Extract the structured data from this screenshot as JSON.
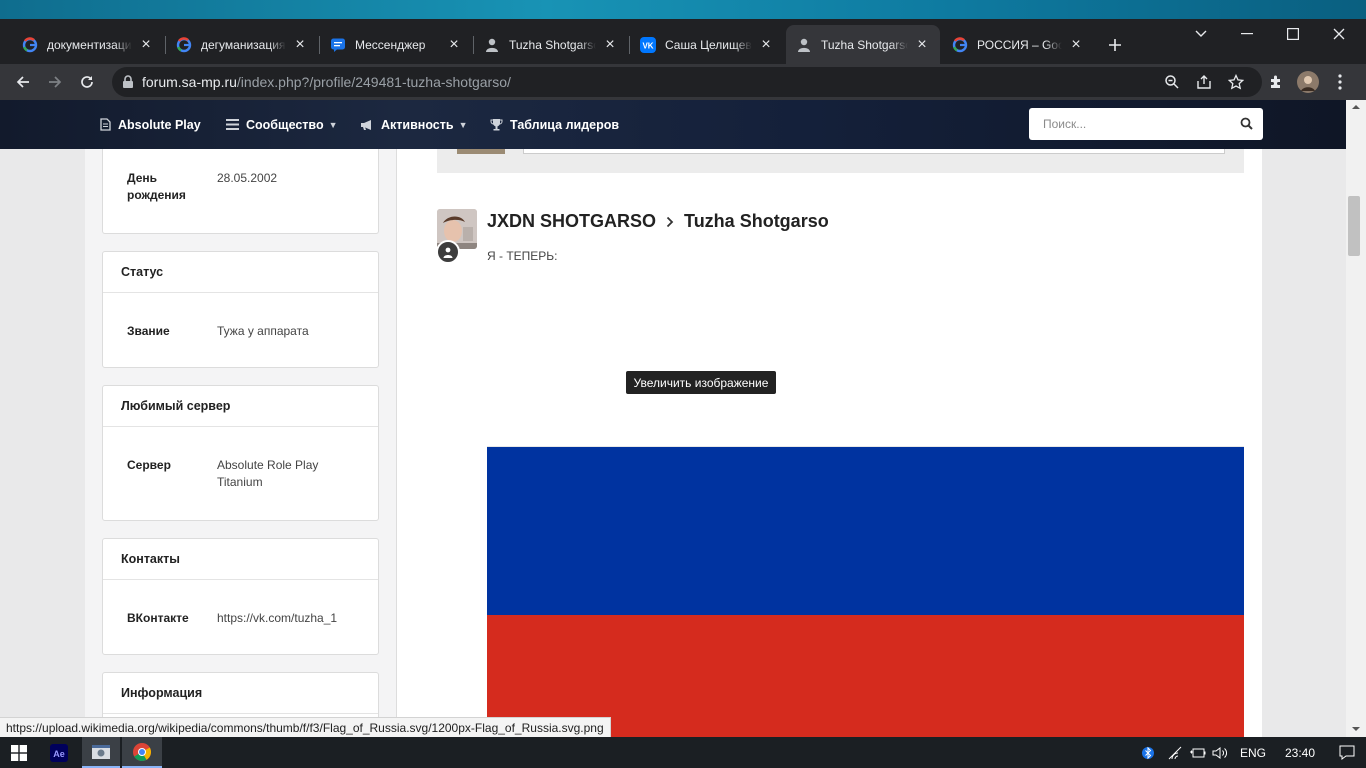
{
  "browser": {
    "tabs": [
      {
        "title": "документизация",
        "favicon": "google-icon"
      },
      {
        "title": "дегуманизация",
        "favicon": "google-icon"
      },
      {
        "title": "Мессенджер",
        "favicon": "messenger-icon"
      },
      {
        "title": "Tuzha Shotgarso",
        "favicon": "user-icon"
      },
      {
        "title": "Саша Целищев",
        "favicon": "vk-icon"
      },
      {
        "title": "Tuzha Shotgarso",
        "favicon": "user-icon",
        "active": true
      },
      {
        "title": "РОССИЯ – Google",
        "favicon": "google-icon"
      }
    ],
    "url_host": "forum.sa-mp.ru",
    "url_path": "/index.php?/profile/249481-tuzha-shotgarso/"
  },
  "nav": {
    "items": [
      {
        "label": "Absolute Play",
        "icon": "document-icon"
      },
      {
        "label": "Сообщество",
        "icon": "list-icon",
        "dropdown": true
      },
      {
        "label": "Активность",
        "icon": "megaphone-icon",
        "dropdown": true
      },
      {
        "label": "Таблица лидеров",
        "icon": "trophy-icon"
      }
    ],
    "search_placeholder": "Поиск..."
  },
  "sidebar": {
    "birthday": {
      "key": "День рождения",
      "value": "28.05.2002"
    },
    "status": {
      "title": "Статус",
      "key": "Звание",
      "value": "Тужа у аппарата"
    },
    "favorite_server": {
      "title": "Любимый сервер",
      "key": "Сервер",
      "value": "Absolute Role Play Titanium"
    },
    "contacts": {
      "title": "Контакты",
      "key": "ВКонтакте",
      "value": "https://vk.com/tuzha_1"
    },
    "info": {
      "title": "Информация"
    }
  },
  "post": {
    "from": "JXDN SHOTGARSO",
    "to": "Tuzha Shotgarso",
    "text": "Я - ТЕПЕРЬ:",
    "tooltip": "Увеличить изображение"
  },
  "status_url": "https://upload.wikimedia.org/wikipedia/commons/thumb/f/f3/Flag_of_Russia.svg/1200px-Flag_of_Russia.svg.png",
  "taskbar": {
    "lang": "ENG",
    "time": "23:40"
  },
  "colors": {
    "flag_blue": "#0033a0",
    "flag_red": "#d52b1e",
    "nav_bg": "#16203a"
  }
}
